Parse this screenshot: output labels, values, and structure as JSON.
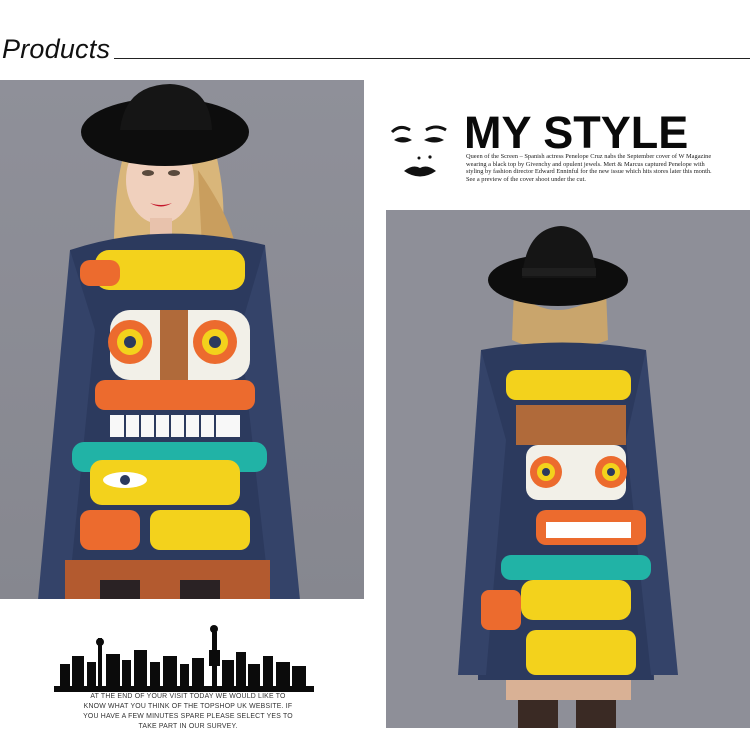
{
  "header": {
    "title": "Products"
  },
  "magazine": {
    "title": "MY STYLE",
    "caption": "Queen of the Screen – Spanish actress Penelope Cruz nabs the September cover of W Magazine wearing a black top by Givenchy and opulent jewels. Mert & Marcus captured Penelope with styling by fashion director Edward Enninful for the new issue which hits stores later this month. See a preview of the cover shoot under the cut."
  },
  "survey": {
    "caption": "AT THE END OF YOUR VISIT TODAY WE WOULD LIKE TO KNOW WHAT YOU THINK OF THE TOPSHOP UK WEBSITE. IF YOU HAVE A FEW MINUTES SPARE PLEASE SELECT YES TO TAKE PART IN OUR SURVEY."
  },
  "colors": {
    "background": "#ffffff",
    "studio_gray": "#8e8f98",
    "sweater_navy": "#2c3a5e",
    "sweater_yellow": "#f3d21c",
    "sweater_orange": "#ec6b2e",
    "sweater_teal": "#21b3a6"
  },
  "icons": [
    "woman-face-sketch-icon",
    "city-skyline-silhouette-icon"
  ]
}
